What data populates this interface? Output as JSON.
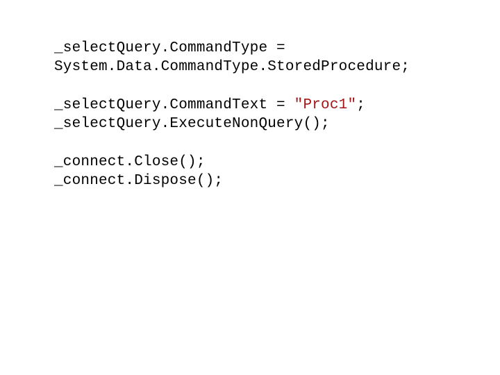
{
  "code": {
    "line1": "_selectQuery.CommandType = ",
    "line2": "System.Data.CommandType.StoredProcedure;",
    "line3": "",
    "line4_pre": "_selectQuery.CommandText = ",
    "line4_string": "\"Proc1\"",
    "line4_post": ";",
    "line5": "_selectQuery.ExecuteNonQuery();",
    "line6": "",
    "line7": "_connect.Close();",
    "line8": "_connect.Dispose();"
  }
}
